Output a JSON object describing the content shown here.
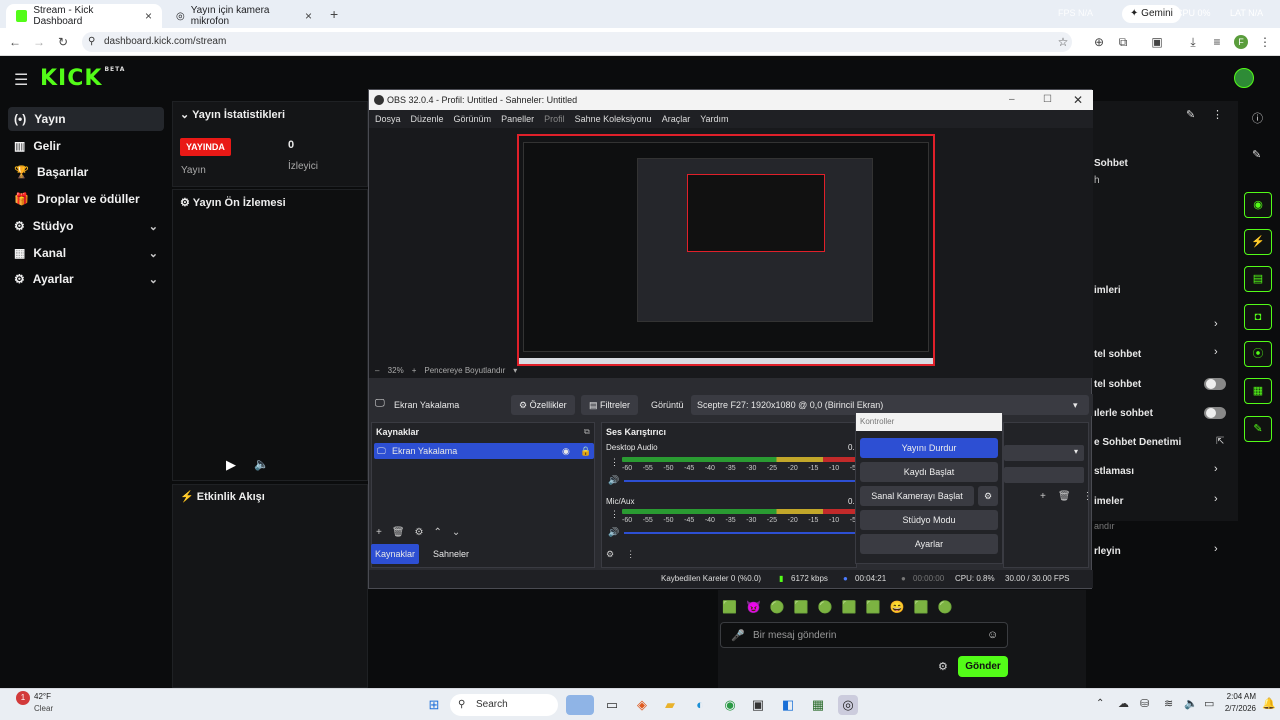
{
  "browser": {
    "tabs": [
      {
        "label": "Stream - Kick Dashboard",
        "close": "×"
      },
      {
        "label": "Yayın için kamera mikrofon",
        "close": "×"
      }
    ],
    "new_tab": "+",
    "url": "dashboard.kick.com/stream",
    "gemini_label": "Gemini",
    "overlay_fps": "FPS N/A",
    "overlay_cpu": "CPU 0%",
    "overlay_lat": "LAT N/A"
  },
  "kick": {
    "logo": "KICK",
    "logo_badge": "BETA",
    "sidebar": [
      {
        "label": "Yayın",
        "icon": "(•)"
      },
      {
        "label": "Gelir",
        "icon": "▥"
      },
      {
        "label": "Başarılar",
        "icon": "🏆"
      },
      {
        "label": "Droplar ve ödüller",
        "icon": "🎁"
      },
      {
        "label": "Stüdyo",
        "icon": "⚙",
        "chevron": "⌄"
      },
      {
        "label": "Kanal",
        "icon": "▦",
        "chevron": "⌄"
      },
      {
        "label": "Ayarlar",
        "icon": "⚙",
        "chevron": "⌄"
      }
    ],
    "stats": {
      "title": "Yayın İstatistikleri",
      "badge": "YAYINDA",
      "stream_label": "Yayın",
      "viewers": "0",
      "viewers_label": "İzleyici"
    },
    "preview_title": "Yayın Ön İzlemesi",
    "activity_title": "Etkinlik Akışı",
    "right_panel": {
      "items": [
        "Sohbet",
        "h",
        "imleri",
        "tel sohbet",
        "tel sohbet",
        "ılerle sohbet",
        "e Sohbet Denetimi",
        "stlaması",
        "imeler",
        "andır",
        "rleyin"
      ]
    },
    "chat": {
      "placeholder": "Bir mesaj gönderin",
      "send": "Gönder",
      "emotes": [
        "🟩",
        "😈",
        "🟢",
        "🟩",
        "🟢",
        "🟩",
        "🟩",
        "😄",
        "🟩",
        "🟢"
      ]
    }
  },
  "obs": {
    "title": "OBS 32.0.4 - Profil: Untitled - Sahneler: Untitled",
    "menu": [
      "Dosya",
      "Düzenle",
      "Görünüm",
      "Paneller",
      "Profil",
      "Sahne Koleksiyonu",
      "Araçlar",
      "Yardım"
    ],
    "zoom": "32%",
    "fit": "Pencereye Boyutlandır",
    "source_bar": {
      "source": "Ekran Yakalama",
      "properties": "Özellikler",
      "filters": "Filtreler",
      "display_label": "Görüntü",
      "display_value": "Sceptre F27: 1920x1080 @ 0,0 (Birincil Ekran)"
    },
    "sources": {
      "title": "Kaynaklar",
      "item": "Ekran Yakalama"
    },
    "tabs": [
      "Kaynaklar",
      "Sahneler"
    ],
    "mixer": {
      "title": "Ses Karıştırıcı",
      "channels": [
        {
          "name": "Desktop Audio",
          "value": "0."
        },
        {
          "name": "Mic/Aux",
          "value": "0."
        }
      ],
      "ticks": [
        "-60",
        "-55",
        "-50",
        "-45",
        "-40",
        "-35",
        "-30",
        "-25",
        "-20",
        "-15",
        "-10",
        "-5"
      ]
    },
    "controls": {
      "title": "Kontroller",
      "buttons": [
        "Yayını Durdur",
        "Kaydı Başlat",
        "Sanal Kamerayı Başlat",
        "Stüdyo Modu",
        "Ayarlar"
      ]
    },
    "status": {
      "dropped": "Kaybedilen Kareler 0 (%0.0)",
      "bitrate": "6172 kbps",
      "stream_time": "00:04:21",
      "rec_time": "00:00:00",
      "cpu": "CPU: 0.8%",
      "fps": "30.00 / 30.00 FPS"
    }
  },
  "taskbar": {
    "weather_temp": "42°F",
    "weather_desc": "Clear",
    "search": "Search",
    "time": "2:04 AM",
    "date": "2/7/2026"
  }
}
